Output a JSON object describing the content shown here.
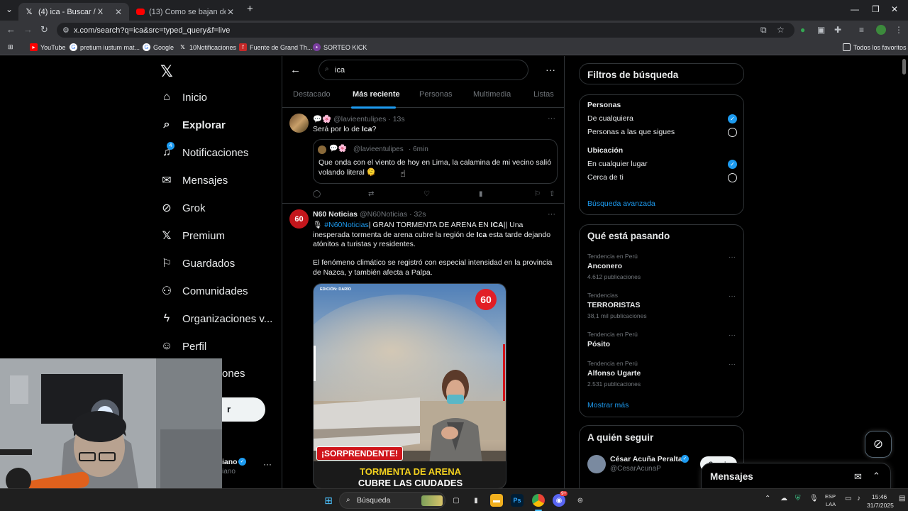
{
  "browser": {
    "tabs": [
      {
        "title": "(4) ica - Buscar / X",
        "active": true
      },
      {
        "title": "(13) Como se bajan de un gusa",
        "active": false
      }
    ],
    "url": "x.com/search?q=ica&src=typed_query&f=live",
    "bookmarks": [
      "YouTube",
      "pretium iustum mat...",
      "Google",
      "10Notificaciones",
      "Fuente de Grand Th...",
      "SORTEO KICK"
    ],
    "all_bookmarks": "Todos los favoritos"
  },
  "nav": {
    "items": [
      {
        "label": "Inicio",
        "icon": "home-icon"
      },
      {
        "label": "Explorar",
        "icon": "search-icon"
      },
      {
        "label": "Notificaciones",
        "icon": "bell-icon",
        "badge": "4"
      },
      {
        "label": "Mensajes",
        "icon": "mail-icon"
      },
      {
        "label": "Grok",
        "icon": "grok-icon"
      },
      {
        "label": "Premium",
        "icon": "x-icon"
      },
      {
        "label": "Guardados",
        "icon": "bookmark-icon"
      },
      {
        "label": "Comunidades",
        "icon": "people-icon"
      },
      {
        "label": "Organizaciones v...",
        "icon": "bolt-icon"
      },
      {
        "label": "Perfil",
        "icon": "person-icon"
      },
      {
        "label": "ones",
        "icon": "more-icon"
      }
    ],
    "post_label": "r",
    "account_name_fragment": "iano",
    "account_handle_fragment": "iano"
  },
  "search": {
    "query": "ica",
    "tabs": [
      "Destacado",
      "Más reciente",
      "Personas",
      "Multimedia",
      "Listas"
    ],
    "active_tab": "Más reciente"
  },
  "tweets": [
    {
      "emojis": "💬🌸",
      "handle": "@lavieentulipes",
      "time": "· 13s",
      "text_before": "Será por lo de ",
      "text_bold": "Ica",
      "text_after": "?",
      "quote": {
        "emojis": "💬🌸",
        "handle": "@lavieentulipes",
        "time": "· 6min",
        "text": "Que onda con el viento de hoy en Lima, la calamina de mi vecino salió volando literal 🫠"
      }
    },
    {
      "name": "N60 Noticias",
      "handle": "@N60Noticias",
      "time": "· 32s",
      "hashtag": "#N60Noticias",
      "p1_a": "| GRAN TORMENTA DE ARENA EN ",
      "p1_b": "ICA",
      "p1_c": "|| Una inesperada tormenta de arena cubre la región de ",
      "p1_d": "Ica",
      "p1_e": " esta tarde dejando atónitos a turistas y residentes.",
      "p2": "El fenómeno climático se registró con especial intensidad en la provincia de Nazca, y también afecta a Palpa.",
      "media": {
        "edition": "EDICIÓN: DARÍO",
        "logo": "60",
        "banner": "¡SORPRENDENTE!",
        "headline1": "TORMENTA DE ARENA",
        "headline2": "CUBRE LAS CIUDADES"
      }
    }
  ],
  "filters": {
    "title": "Filtros de búsqueda",
    "people_title": "Personas",
    "people_options": [
      "De cualquiera",
      "Personas a las que sigues"
    ],
    "people_selected": 0,
    "location_title": "Ubicación",
    "location_options": [
      "En cualquier lugar",
      "Cerca de ti"
    ],
    "location_selected": 0,
    "advanced": "Búsqueda avanzada"
  },
  "trends": {
    "title": "Qué está pasando",
    "items": [
      {
        "context": "Tendencia en Perú",
        "name": "Anconero",
        "count": "4.612 publicaciones"
      },
      {
        "context": "Tendencias",
        "name": "TERRORISTAS",
        "count": "38,1 mil publicaciones"
      },
      {
        "context": "Tendencia en Perú",
        "name": "Pósito",
        "count": ""
      },
      {
        "context": "Tendencia en Perú",
        "name": "Alfonso Ugarte",
        "count": "2.531 publicaciones"
      }
    ],
    "show_more": "Mostrar más"
  },
  "follow": {
    "title": "A quién seguir",
    "name": "César Acuña Peralta",
    "handle": "@CesarAcunaP",
    "button": "Seguir"
  },
  "messages_drawer": "Mensajes",
  "taskbar": {
    "search": "Búsqueda",
    "lang1": "ESP",
    "lang2": "LAA",
    "time": "15:46",
    "date": "31/7/2025",
    "discord_badge": "9+"
  },
  "colors": {
    "accent": "#1d9bf0",
    "bg": "#000000",
    "border": "#2f3336",
    "muted": "#71767b"
  }
}
